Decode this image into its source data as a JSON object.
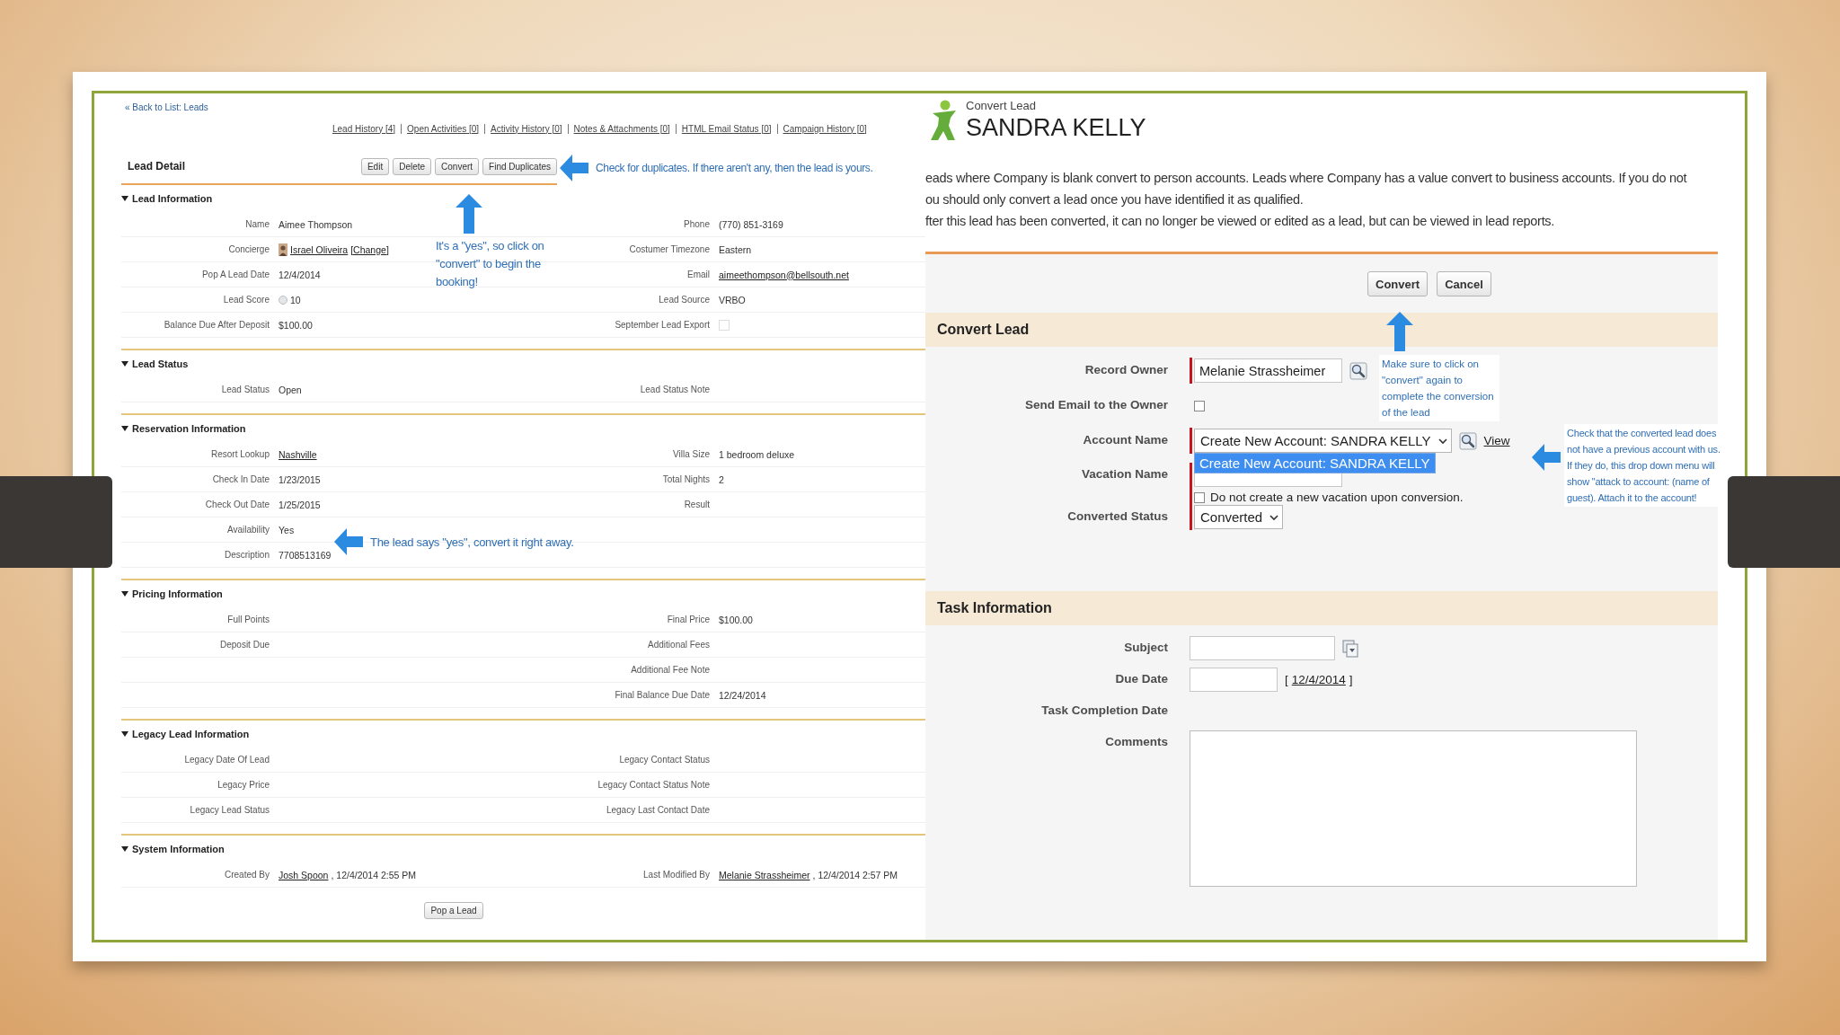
{
  "lead_detail": {
    "back_link": "« Back to List: Leads",
    "related_links": [
      "Lead History [4]",
      "Open Activities [0]",
      "Activity History [0]",
      "Notes & Attachments [0]",
      "HTML Email Status [0]",
      "Campaign History [0]"
    ],
    "title": "Lead Detail",
    "buttons": [
      "Edit",
      "Delete",
      "Convert",
      "Find Duplicates"
    ],
    "sections": [
      {
        "title": "Lead Information",
        "expanded": true,
        "rows": [
          {
            "left": {
              "label": "Name",
              "value": "Aimee Thompson"
            },
            "right": {
              "label": "Phone",
              "value": "(770) 851-3169"
            }
          },
          {
            "left": {
              "label": "Concierge",
              "value": "Israel Oliveira",
              "link": true,
              "avatar": true,
              "action": "[Change]"
            },
            "right": {
              "label": "Costumer Timezone",
              "value": "Eastern"
            }
          },
          {
            "left": {
              "label": "Pop A Lead Date",
              "value": "12/4/2014"
            },
            "right": {
              "label": "Email",
              "value": "aimeethompson@bellsouth.net",
              "link": true
            }
          },
          {
            "left": {
              "label": "Lead Score",
              "value": "10",
              "info_icon": true
            },
            "right": {
              "label": "Lead Source",
              "value": "VRBO"
            }
          },
          {
            "left": {
              "label": "Balance Due After Deposit",
              "value": "$100.00"
            },
            "right": {
              "label": "September Lead Export",
              "kind": "checkbox",
              "checked": false
            }
          }
        ]
      },
      {
        "title": "Lead Status",
        "expanded": true,
        "rows": [
          {
            "left": {
              "label": "Lead Status",
              "value": "Open"
            },
            "right": {
              "label": "Lead Status Note"
            }
          }
        ]
      },
      {
        "title": "Reservation Information",
        "expanded": true,
        "rows": [
          {
            "left": {
              "label": "Resort Lookup",
              "value": "Nashville",
              "link": true
            },
            "right": {
              "label": "Villa Size",
              "value": "1 bedroom deluxe"
            }
          },
          {
            "left": {
              "label": "Check In Date",
              "value": "1/23/2015"
            },
            "right": {
              "label": "Total Nights",
              "value": "2"
            }
          },
          {
            "left": {
              "label": "Check Out Date",
              "value": "1/25/2015"
            },
            "right": {
              "label": "Result"
            }
          },
          {
            "left": {
              "label": "Availability",
              "value": "Yes"
            }
          },
          {
            "left": {
              "label": "Description",
              "value": "7708513169"
            }
          }
        ]
      },
      {
        "title": "Pricing Information",
        "expanded": true,
        "rows": [
          {
            "left": {
              "label": "Full Points"
            },
            "right": {
              "label": "Final Price",
              "value": "$100.00"
            }
          },
          {
            "left": {
              "label": "Deposit Due"
            },
            "right": {
              "label": "Additional Fees"
            }
          },
          {
            "right": {
              "label": "Additional Fee Note"
            }
          },
          {
            "right": {
              "label": "Final Balance Due Date",
              "value": "12/24/2014"
            }
          }
        ]
      },
      {
        "title": "Legacy Lead Information",
        "expanded": true,
        "rows": [
          {
            "left": {
              "label": "Legacy Date Of Lead"
            },
            "right": {
              "label": "Legacy Contact Status"
            }
          },
          {
            "left": {
              "label": "Legacy Price"
            },
            "right": {
              "label": "Legacy Contact Status Note"
            }
          },
          {
            "left": {
              "label": "Legacy Lead Status"
            },
            "right": {
              "label": "Legacy Last Contact Date"
            }
          }
        ]
      },
      {
        "title": "System Information",
        "expanded": true,
        "rows": [
          {
            "left": {
              "label": "Created By",
              "value": "Josh Spoon",
              "link": true,
              "suffix": ", 12/4/2014 2:55 PM"
            },
            "right": {
              "label": "Last Modified By",
              "value": "Melanie Strassheimer",
              "link": true,
              "suffix": ", 12/4/2014 2:57 PM"
            }
          }
        ]
      }
    ],
    "bottom_buttons": [
      "Pop a Lead"
    ],
    "annotations": [
      {
        "kind": "left_arrow",
        "text": "Check for duplicates. If there aren't any, then the lead is yours."
      },
      {
        "kind": "up_arrow",
        "text": "It's a \"yes\", so click on \"convert\" to begin the booking!"
      },
      {
        "kind": "left_arrow",
        "text": "The lead says \"yes\", convert it right away."
      }
    ]
  },
  "convert_lead": {
    "subtitle": "Convert Lead",
    "title": "SANDRA KELLY",
    "notes": [
      "eads where Company is blank convert to person accounts. Leads where Company has a value convert to business accounts. If you do not",
      "ou should only convert a lead once you have identified it as qualified.",
      "fter this lead has been converted, it can no longer be viewed or edited as a lead, but can be viewed in lead reports."
    ],
    "buttons": [
      "Convert",
      "Cancel"
    ],
    "section": {
      "title": "Convert Lead",
      "fields": [
        {
          "label": "Record Owner",
          "kind": "lookup",
          "value": "Melanie Strassheimer",
          "required": true
        },
        {
          "label": "Send Email to the Owner",
          "kind": "checkbox",
          "checked": false
        },
        {
          "label": "Account Name",
          "kind": "select",
          "value": "Create New Account: SANDRA KELLY",
          "required": true,
          "lookup": true,
          "link": "View",
          "expanded": true,
          "options": [
            {
              "label": "Create New Account: SANDRA KELLY",
              "selected": true
            }
          ]
        },
        {
          "label": "Vacation Name",
          "kind": "text_input",
          "required": true,
          "option": {
            "label": "Do not create a new vacation upon conversion.",
            "checked": false
          }
        },
        {
          "label": "Converted Status",
          "kind": "select",
          "value": "Converted",
          "required": true,
          "expanded": false
        }
      ]
    },
    "task_section": {
      "title": "Task Information",
      "fields": [
        {
          "label": "Subject",
          "kind": "combo"
        },
        {
          "label": "Due Date",
          "kind": "date",
          "bracket_open": "[",
          "link": "12/4/2014",
          "bracket_close": "]"
        },
        {
          "label": "Task Completion Date",
          "kind": "none"
        },
        {
          "label": "Comments",
          "kind": "textarea"
        }
      ]
    },
    "annotations": [
      {
        "kind": "up_arrow",
        "text": "Make sure to click on \"convert\" again to complete the conversion of the lead"
      },
      {
        "kind": "left_arrow",
        "text": "Check that the converted lead does not have a previous account with us. If they do, this drop down menu will show \"attack to account: (name of guest). Attach it to the account!"
      }
    ]
  }
}
